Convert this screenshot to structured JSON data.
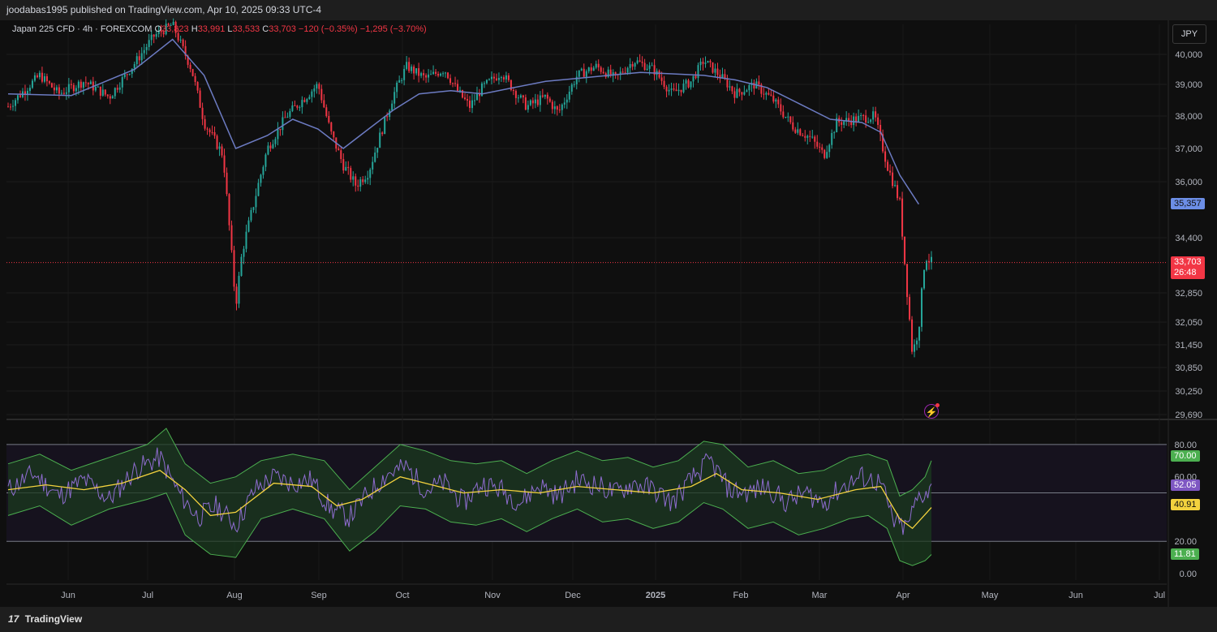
{
  "header": {
    "publisher_line": "joodabas1995 published on TradingView.com, Apr 10, 2025 09:33 UTC-4"
  },
  "legend": {
    "symbol": "Japan 225 CFD · 4h · FOREXCOM",
    "open_label": "O",
    "open_value": "33,823",
    "high_label": "H",
    "high_value": "33,991",
    "low_label": "L",
    "low_value": "33,533",
    "close_label": "C",
    "close_value": "33,703",
    "change": "−120 (−0.35%)",
    "change2": "−1,295 (−3.70%)"
  },
  "currency": "JPY",
  "footer": {
    "brand": "TradingView",
    "brand_mark": "17"
  },
  "colors": {
    "background": "#0f0f0f",
    "up": "#26a69a",
    "down": "#f23645",
    "ma": "#6c7bc2",
    "rsi": "#8e6ccf",
    "rsi_ma": "#f3d23e",
    "band": "#4caf50",
    "band_fill": "#1e3a22"
  },
  "chart_data": [
    {
      "type": "candlestick",
      "name": "Japan 225 CFD",
      "x_ticks": [
        "Jun",
        "Jul",
        "Aug",
        "Sep",
        "Oct",
        "Nov",
        "Dec",
        "2025",
        "Feb",
        "Mar",
        "Apr",
        "May",
        "Jun",
        "Jul"
      ],
      "y_ticks": [
        "40,000",
        "39,000",
        "38,000",
        "37,000",
        "36,000",
        "34,400",
        "32,850",
        "32,050",
        "31,450",
        "30,850",
        "30,250",
        "29,690"
      ],
      "y_tick_values": [
        40000,
        39000,
        38000,
        37000,
        36000,
        34400,
        32850,
        32050,
        31450,
        30850,
        30250,
        29690
      ],
      "close_path": [
        [
          0,
          38300
        ],
        [
          3,
          38900
        ],
        [
          5,
          39300
        ],
        [
          8,
          38700
        ],
        [
          12,
          39100
        ],
        [
          16,
          38600
        ],
        [
          20,
          39700
        ],
        [
          23,
          40600
        ],
        [
          26,
          41000
        ],
        [
          29,
          39500
        ],
        [
          31,
          37800
        ],
        [
          34,
          36800
        ],
        [
          36,
          32500
        ],
        [
          37,
          34000
        ],
        [
          39,
          35500
        ],
        [
          41,
          37000
        ],
        [
          44,
          38000
        ],
        [
          47,
          38600
        ],
        [
          49,
          39000
        ],
        [
          51,
          37500
        ],
        [
          53,
          36500
        ],
        [
          55,
          35900
        ],
        [
          57,
          36300
        ],
        [
          59,
          37500
        ],
        [
          61,
          38700
        ],
        [
          63,
          39600
        ],
        [
          66,
          39200
        ],
        [
          69,
          39500
        ],
        [
          71,
          38800
        ],
        [
          73,
          38300
        ],
        [
          75,
          38900
        ],
        [
          78,
          39400
        ],
        [
          80,
          38800
        ],
        [
          82,
          38300
        ],
        [
          85,
          38600
        ],
        [
          87,
          38100
        ],
        [
          90,
          39300
        ],
        [
          93,
          39600
        ],
        [
          96,
          39200
        ],
        [
          99,
          39800
        ],
        [
          102,
          39500
        ],
        [
          105,
          38700
        ],
        [
          108,
          39100
        ],
        [
          110,
          39800
        ],
        [
          113,
          39200
        ],
        [
          115,
          38700
        ],
        [
          118,
          39000
        ],
        [
          121,
          38500
        ],
        [
          124,
          37700
        ],
        [
          127,
          37300
        ],
        [
          129,
          36800
        ],
        [
          131,
          37800
        ],
        [
          134,
          37900
        ],
        [
          137,
          38000
        ],
        [
          139,
          36500
        ],
        [
          141,
          35400
        ],
        [
          142,
          33200
        ],
        [
          143,
          31200
        ],
        [
          144,
          31900
        ],
        [
          145,
          33900
        ],
        [
          146,
          33703
        ]
      ],
      "close_x_range": [
        0,
        146
      ],
      "ma_path": [
        [
          0,
          38700
        ],
        [
          10,
          38650
        ],
        [
          20,
          39500
        ],
        [
          26,
          40500
        ],
        [
          31,
          39300
        ],
        [
          36,
          37000
        ],
        [
          41,
          37400
        ],
        [
          45,
          37900
        ],
        [
          49,
          37600
        ],
        [
          53,
          37000
        ],
        [
          57,
          37600
        ],
        [
          61,
          38200
        ],
        [
          65,
          38700
        ],
        [
          70,
          38800
        ],
        [
          75,
          38700
        ],
        [
          80,
          38900
        ],
        [
          85,
          39100
        ],
        [
          90,
          39200
        ],
        [
          95,
          39300
        ],
        [
          100,
          39400
        ],
        [
          105,
          39350
        ],
        [
          110,
          39300
        ],
        [
          115,
          39150
        ],
        [
          120,
          38900
        ],
        [
          125,
          38400
        ],
        [
          130,
          37900
        ],
        [
          135,
          37800
        ],
        [
          138,
          37500
        ],
        [
          141,
          36200
        ],
        [
          144,
          35357
        ]
      ],
      "last_price": 33703,
      "last_price_label": "33,703",
      "countdown": "26:48",
      "ma_value": 35357,
      "ma_label": "35,357"
    },
    {
      "type": "line",
      "name": "RSI",
      "y_ticks": [
        "80.00",
        "60.00",
        "20.00",
        "0.00"
      ],
      "y_tick_values": [
        80,
        60,
        20,
        0
      ],
      "levels": [
        80,
        50,
        20
      ],
      "rsi_path": [
        [
          0,
          52
        ],
        [
          4,
          62
        ],
        [
          8,
          48
        ],
        [
          12,
          58
        ],
        [
          16,
          46
        ],
        [
          20,
          64
        ],
        [
          24,
          72
        ],
        [
          27,
          50
        ],
        [
          30,
          35
        ],
        [
          33,
          42
        ],
        [
          36,
          30
        ],
        [
          39,
          52
        ],
        [
          42,
          60
        ],
        [
          45,
          56
        ],
        [
          48,
          58
        ],
        [
          51,
          40
        ],
        [
          54,
          35
        ],
        [
          57,
          50
        ],
        [
          60,
          62
        ],
        [
          63,
          66
        ],
        [
          66,
          52
        ],
        [
          69,
          56
        ],
        [
          72,
          44
        ],
        [
          75,
          56
        ],
        [
          78,
          52
        ],
        [
          81,
          44
        ],
        [
          84,
          55
        ],
        [
          87,
          48
        ],
        [
          90,
          58
        ],
        [
          93,
          55
        ],
        [
          96,
          50
        ],
        [
          99,
          56
        ],
        [
          102,
          52
        ],
        [
          105,
          44
        ],
        [
          108,
          58
        ],
        [
          111,
          70
        ],
        [
          114,
          52
        ],
        [
          117,
          50
        ],
        [
          120,
          54
        ],
        [
          123,
          44
        ],
        [
          126,
          50
        ],
        [
          129,
          44
        ],
        [
          132,
          54
        ],
        [
          135,
          60
        ],
        [
          138,
          56
        ],
        [
          140,
          32
        ],
        [
          142,
          28
        ],
        [
          144,
          48
        ],
        [
          146,
          52.05
        ]
      ],
      "rsi_ma_path": [
        [
          0,
          52
        ],
        [
          6,
          55
        ],
        [
          12,
          52
        ],
        [
          18,
          56
        ],
        [
          24,
          64
        ],
        [
          28,
          52
        ],
        [
          32,
          36
        ],
        [
          36,
          38
        ],
        [
          42,
          56
        ],
        [
          48,
          54
        ],
        [
          52,
          42
        ],
        [
          56,
          46
        ],
        [
          62,
          60
        ],
        [
          66,
          56
        ],
        [
          72,
          50
        ],
        [
          78,
          52
        ],
        [
          84,
          50
        ],
        [
          90,
          54
        ],
        [
          96,
          52
        ],
        [
          102,
          50
        ],
        [
          108,
          54
        ],
        [
          112,
          62
        ],
        [
          116,
          52
        ],
        [
          122,
          50
        ],
        [
          128,
          46
        ],
        [
          134,
          52
        ],
        [
          138,
          54
        ],
        [
          141,
          34
        ],
        [
          143,
          28
        ],
        [
          146,
          40.91
        ]
      ],
      "upper_band_path": [
        [
          0,
          68
        ],
        [
          5,
          74
        ],
        [
          10,
          64
        ],
        [
          16,
          72
        ],
        [
          22,
          80
        ],
        [
          25,
          90
        ],
        [
          28,
          68
        ],
        [
          32,
          56
        ],
        [
          36,
          60
        ],
        [
          40,
          70
        ],
        [
          45,
          74
        ],
        [
          50,
          70
        ],
        [
          54,
          52
        ],
        [
          58,
          66
        ],
        [
          62,
          80
        ],
        [
          66,
          76
        ],
        [
          70,
          70
        ],
        [
          74,
          68
        ],
        [
          78,
          70
        ],
        [
          82,
          62
        ],
        [
          86,
          70
        ],
        [
          90,
          76
        ],
        [
          94,
          70
        ],
        [
          98,
          72
        ],
        [
          102,
          66
        ],
        [
          106,
          70
        ],
        [
          110,
          82
        ],
        [
          113,
          80
        ],
        [
          117,
          66
        ],
        [
          121,
          70
        ],
        [
          125,
          62
        ],
        [
          129,
          64
        ],
        [
          133,
          72
        ],
        [
          136,
          74
        ],
        [
          139,
          70
        ],
        [
          141,
          48
        ],
        [
          143,
          52
        ],
        [
          145,
          60
        ],
        [
          146,
          70
        ]
      ],
      "lower_band_path": [
        [
          0,
          36
        ],
        [
          5,
          42
        ],
        [
          10,
          30
        ],
        [
          16,
          40
        ],
        [
          22,
          46
        ],
        [
          25,
          50
        ],
        [
          28,
          24
        ],
        [
          32,
          12
        ],
        [
          36,
          10
        ],
        [
          40,
          34
        ],
        [
          45,
          40
        ],
        [
          50,
          34
        ],
        [
          54,
          14
        ],
        [
          58,
          26
        ],
        [
          62,
          42
        ],
        [
          66,
          40
        ],
        [
          70,
          32
        ],
        [
          74,
          30
        ],
        [
          78,
          34
        ],
        [
          82,
          26
        ],
        [
          86,
          34
        ],
        [
          90,
          40
        ],
        [
          94,
          32
        ],
        [
          98,
          34
        ],
        [
          102,
          28
        ],
        [
          106,
          32
        ],
        [
          110,
          44
        ],
        [
          113,
          40
        ],
        [
          117,
          28
        ],
        [
          121,
          32
        ],
        [
          125,
          24
        ],
        [
          129,
          28
        ],
        [
          133,
          34
        ],
        [
          136,
          36
        ],
        [
          139,
          28
        ],
        [
          141,
          8
        ],
        [
          143,
          5
        ],
        [
          145,
          8
        ],
        [
          146,
          11.81
        ]
      ],
      "x_range": [
        0,
        146
      ],
      "y_range": [
        -4,
        94
      ],
      "upper_label": "70.00",
      "rsi_label": "52.05",
      "rsi_ma_label": "40.91",
      "lower_label": "11.81"
    }
  ]
}
